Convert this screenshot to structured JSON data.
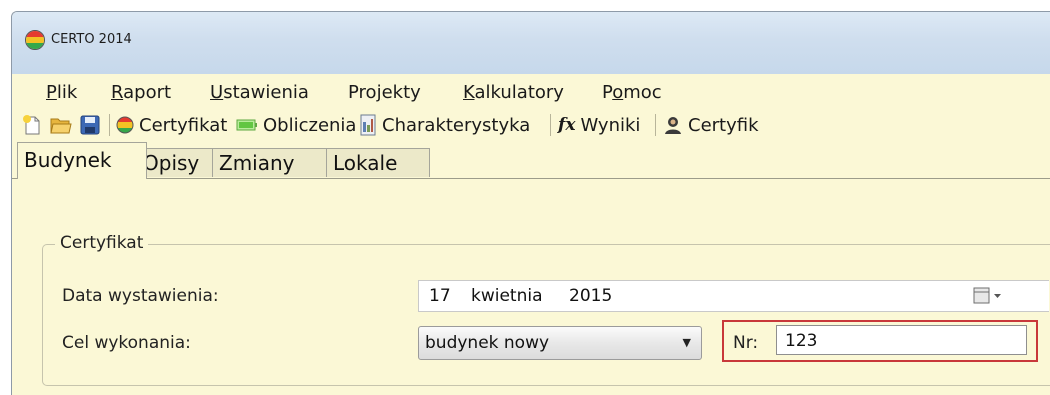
{
  "window": {
    "title": "CERTO 2014",
    "app_icon": "certo-logo-icon"
  },
  "menu": [
    {
      "label": "Plik",
      "mnemonic": "P"
    },
    {
      "label": "Raport",
      "mnemonic": "R"
    },
    {
      "label": "Ustawienia",
      "mnemonic": "U"
    },
    {
      "label": "Projekty",
      "mnemonic": "j"
    },
    {
      "label": "Kalkulatory",
      "mnemonic": "K"
    },
    {
      "label": "Pomoc",
      "mnemonic": "o"
    }
  ],
  "toolbar": {
    "new_icon": "new-document-icon",
    "open_icon": "open-folder-icon",
    "save_icon": "save-disk-icon",
    "certyfikat_label": "Certyfikat",
    "obliczenia_label": "Obliczenia",
    "charakterystyka_label": "Charakterystyka",
    "wyniki_label": "Wyniki",
    "certyfik_label": "Certyfik"
  },
  "tabs": [
    {
      "label": "Budynek",
      "active": true
    },
    {
      "label": "Opisy",
      "active": false
    },
    {
      "label": "Zmiany",
      "active": false
    },
    {
      "label": "Lokale",
      "active": false
    }
  ],
  "certyfikat_group": {
    "legend": "Certyfikat",
    "date_label": "Data wystawienia:",
    "date": {
      "day": "17",
      "month": "kwietnia",
      "year": "2015"
    },
    "purpose_label": "Cel wykonania:",
    "purpose_value": "budynek nowy",
    "nr_label": "Nr:",
    "nr_value": "123"
  },
  "colors": {
    "highlight": "#c8383a",
    "window_bg": "#fbf8d6",
    "titlebar": "#cfdeee"
  }
}
